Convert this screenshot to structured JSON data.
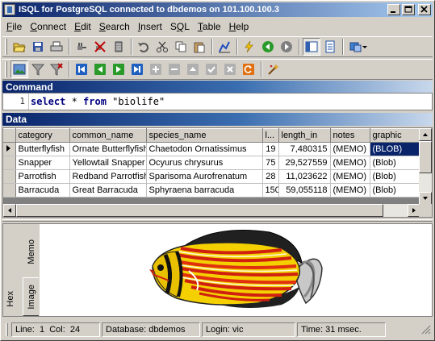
{
  "window": {
    "title": "ISQL for PostgreSQL connected to dbdemos on 101.100.100.3"
  },
  "menu": [
    "File",
    "Connect",
    "Edit",
    "Search",
    "Insert",
    "SQL",
    "Table",
    "Help"
  ],
  "menu_underline": [
    "F",
    "C",
    "E",
    "S",
    "I",
    "Q",
    "T",
    "H"
  ],
  "command": {
    "header": "Command",
    "line_number": "1",
    "kw1": "select",
    "star": " * ",
    "kw2": "from",
    "table": " \"biolife\""
  },
  "data_panel": {
    "header": "Data",
    "columns": [
      "category",
      "common_name",
      "species_name",
      "l...",
      "length_in",
      "notes",
      "graphic"
    ],
    "rows": [
      [
        "Butterflyfish",
        "Ornate Butterflyfish",
        "Chaetodon Ornatissimus",
        "19",
        "7,480315",
        "(MEMO)",
        "(BLOB)"
      ],
      [
        "Snapper",
        "Yellowtail Snapper",
        "Ocyurus chrysurus",
        "75",
        "29,527559",
        "(MEMO)",
        "(Blob)"
      ],
      [
        "Parrotfish",
        "Redband Parrotfish",
        "Sparisoma Aurofrenatum",
        "28",
        "11,023622",
        "(MEMO)",
        "(Blob)"
      ],
      [
        "Barracuda",
        "Great Barracuda",
        "Sphyraena barracuda",
        "150",
        "59,055118",
        "(MEMO)",
        "(Blob)"
      ]
    ]
  },
  "viewer": {
    "tabs": [
      "Memo",
      "Image",
      "Hex"
    ]
  },
  "status": {
    "line_col": "Line:  1  Col:  24",
    "database": "Database: dbdemos",
    "login": "Login: vic",
    "time": "Time: 31 msec."
  },
  "colors": {
    "title_from": "#0a246a",
    "title_to": "#a6caf0",
    "selection": "#0a246a"
  }
}
